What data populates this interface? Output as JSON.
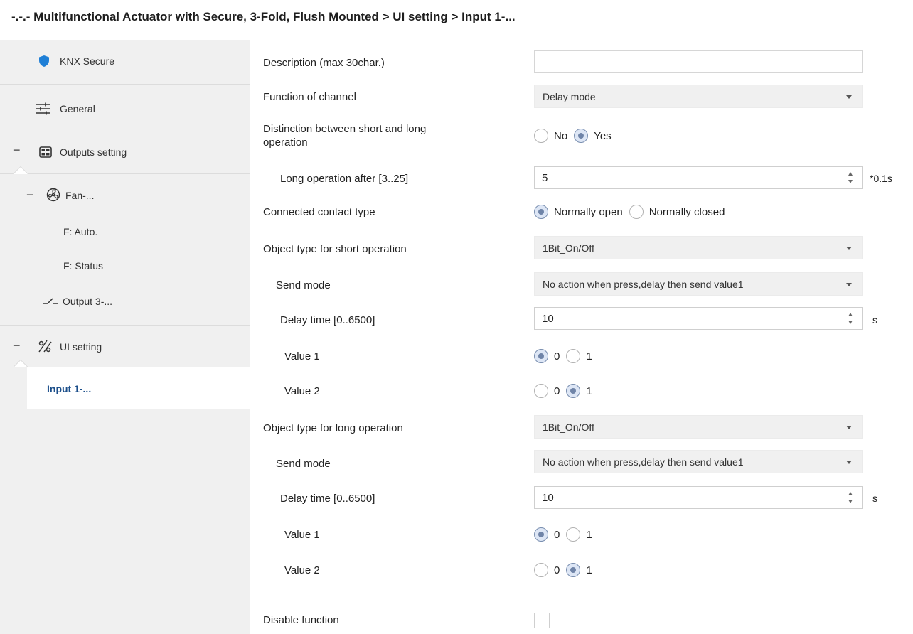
{
  "window": {
    "title": "-.-.- Multifunctional Actuator with Secure, 3-Fold, Flush Mounted > UI setting > Input 1-..."
  },
  "sidebar": {
    "items": [
      {
        "label": "KNX Secure",
        "icon": "shield-icon"
      },
      {
        "label": "General",
        "icon": "sliders-icon"
      },
      {
        "label": "Outputs setting",
        "icon": "grid-icon",
        "expanded": true
      },
      {
        "label": "Fan-...",
        "icon": "fan-icon",
        "expanded": true
      },
      {
        "label": "F: Auto."
      },
      {
        "label": "F: Status"
      },
      {
        "label": "Output 3-...",
        "icon": "switch-icon"
      },
      {
        "label": "UI setting",
        "icon": "ui-setting-icon",
        "expanded": true
      },
      {
        "label": "Input 1-...",
        "selected": true
      }
    ]
  },
  "form": {
    "description": {
      "label": "Description (max 30char.)",
      "value": ""
    },
    "function_of_channel": {
      "label": "Function of channel",
      "value": "Delay mode"
    },
    "distinction": {
      "label_line1": "Distinction between short and long",
      "label_line2": "operation",
      "options": [
        "No",
        "Yes"
      ],
      "selected": "Yes"
    },
    "long_operation_after": {
      "label": "Long operation after [3..25]",
      "value": "5",
      "unit": "*0.1s"
    },
    "connected_contact_type": {
      "label": "Connected contact type",
      "options": [
        "Normally open",
        "Normally closed"
      ],
      "selected": "Normally open"
    },
    "short_object_type": {
      "label": "Object type for short operation",
      "value": "1Bit_On/Off"
    },
    "short_send_mode": {
      "label": "Send mode",
      "value": "No action when press,delay then send value1"
    },
    "short_delay_time": {
      "label": "Delay time [0..6500]",
      "value": "10",
      "unit": "s"
    },
    "short_value1": {
      "label": "Value 1",
      "options": [
        "0",
        "1"
      ],
      "selected": "0"
    },
    "short_value2": {
      "label": "Value 2",
      "options": [
        "0",
        "1"
      ],
      "selected": "1"
    },
    "long_object_type": {
      "label": "Object type for long operation",
      "value": "1Bit_On/Off"
    },
    "long_send_mode": {
      "label": "Send mode",
      "value": "No action when press,delay then send value1"
    },
    "long_delay_time": {
      "label": "Delay time [0..6500]",
      "value": "10",
      "unit": "s"
    },
    "long_value1": {
      "label": "Value 1",
      "options": [
        "0",
        "1"
      ],
      "selected": "0"
    },
    "long_value2": {
      "label": "Value 2",
      "options": [
        "0",
        "1"
      ],
      "selected": "1"
    },
    "disable_function": {
      "label": "Disable function",
      "checked": false
    }
  },
  "colors": {
    "accent": "#1b4e8a",
    "shield": "#1f7fd6",
    "sidebar_bg": "#f0f0f0",
    "select_bg": "#f0f0f0"
  }
}
